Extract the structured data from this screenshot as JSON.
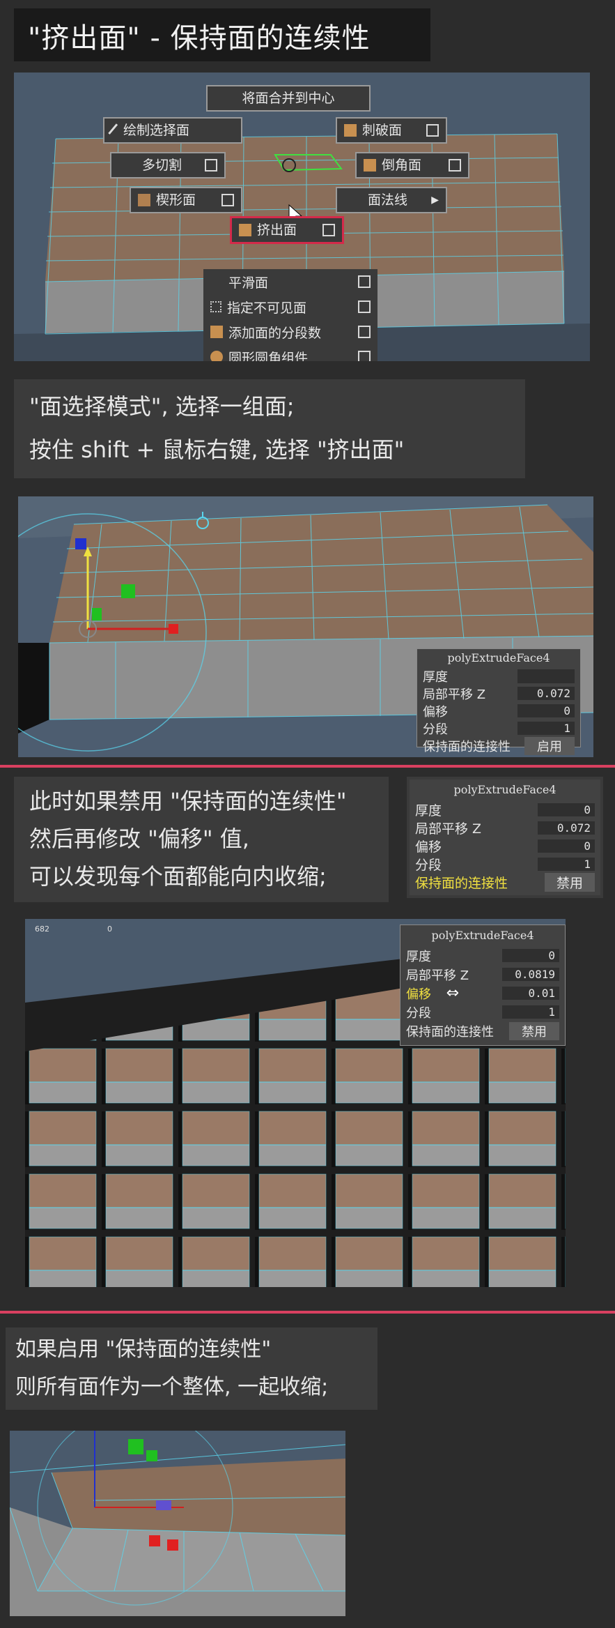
{
  "title": "\"挤出面\" - 保持面的连续性",
  "shot1": {
    "buttons": {
      "merge_center": "将面合并到中心",
      "paint_select": "绘制选择面",
      "poke": "刺破面",
      "multi_cut": "多切割",
      "bevel": "倒角面",
      "wedge": "楔形面",
      "normals": "面法线",
      "extrude": "挤出面"
    },
    "menu": [
      "平滑面",
      "指定不可见面",
      "添加面的分段数",
      "圆形圆角组件"
    ]
  },
  "text1": {
    "line1": "\"面选择模式\", 选择一组面;",
    "line2": "按住 shift + 鼠标右键, 选择 \"挤出面\""
  },
  "panel1": {
    "title": "polyExtrudeFace4",
    "rows": [
      {
        "label": "厚度",
        "value": ""
      },
      {
        "label": "局部平移 Z",
        "value": "0.072"
      },
      {
        "label": "偏移",
        "value": "0"
      },
      {
        "label": "分段",
        "value": "1"
      },
      {
        "label": "保持面的连接性",
        "value": "启用"
      }
    ]
  },
  "text2": {
    "line1": "此时如果禁用 \"保持面的连续性\"",
    "line2": "然后再修改 \"偏移\" 值,",
    "line3": "可以发现每个面都能向内收缩;"
  },
  "panel2": {
    "title": "polyExtrudeFace4",
    "rows": [
      {
        "label": "厚度",
        "value": "0"
      },
      {
        "label": "局部平移 Z",
        "value": "0.072"
      },
      {
        "label": "偏移",
        "value": "0"
      },
      {
        "label": "分段",
        "value": "1"
      },
      {
        "label": "保持面的连接性",
        "value": "禁用"
      }
    ]
  },
  "shot3": {
    "hud_left": "682",
    "hud_right": "0"
  },
  "panel3": {
    "title": "polyExtrudeFace4",
    "rows": [
      {
        "label": "厚度",
        "value": "0"
      },
      {
        "label": "局部平移 Z",
        "value": "0.0819"
      },
      {
        "label": "偏移",
        "value": "0.01"
      },
      {
        "label": "分段",
        "value": "1"
      },
      {
        "label": "保持面的连接性",
        "value": "禁用"
      }
    ]
  },
  "text3": {
    "line1": "如果启用 \"保持面的连续性\"",
    "line2": "则所有面作为一个整体, 一起收缩;"
  },
  "colors": {
    "accent_red": "#d94060",
    "highlight_yellow": "#f0e040",
    "wire_cyan": "#5ad6ee"
  }
}
